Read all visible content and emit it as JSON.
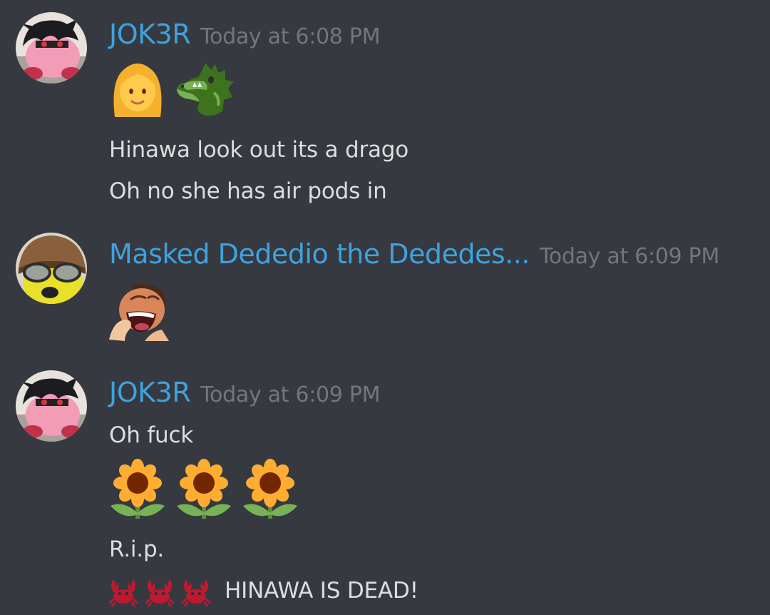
{
  "messages": [
    {
      "username": "JOK3R",
      "timestamp": "Today at 6:08 PM",
      "avatar": "kirby-joker-avatar",
      "emoji_row": [
        "woman-emoji",
        "dragon-face-emoji"
      ],
      "lines": [
        "Hinawa look out its a drago",
        "Oh no she has air pods in"
      ]
    },
    {
      "username": "Masked Dededio the Dededes...",
      "timestamp": "Today at 6:09 PM",
      "avatar": "masked-dedede-avatar",
      "emoji_row": [
        "laughing-man-emote"
      ]
    },
    {
      "username": "JOK3R",
      "timestamp": "Today at 6:09 PM",
      "avatar": "kirby-joker-avatar",
      "line1": "Oh fuck",
      "emoji_row": [
        "sunflower-emoji",
        "sunflower-emoji",
        "sunflower-emoji"
      ],
      "line2": "R.i.p.",
      "crab_emojis": [
        "crab-emoji",
        "crab-emoji",
        "crab-emoji"
      ],
      "line3": "HINAWA IS DEAD!"
    }
  ],
  "colors": {
    "background": "#36393f",
    "username": "#3ea2de",
    "timestamp": "#72767d",
    "text": "#dcddde"
  }
}
